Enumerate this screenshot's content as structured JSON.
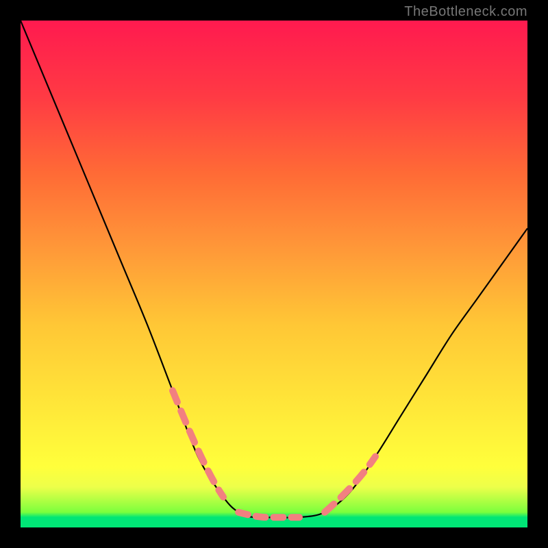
{
  "watermark": "TheBottleneck.com",
  "chart_data": {
    "type": "line",
    "title": "",
    "xlabel": "",
    "ylabel": "",
    "x": [
      0.0,
      0.05,
      0.1,
      0.15,
      0.2,
      0.25,
      0.3,
      0.35,
      0.4,
      0.43,
      0.46,
      0.5,
      0.55,
      0.6,
      0.65,
      0.7,
      0.75,
      0.8,
      0.85,
      0.9,
      0.95,
      1.0
    ],
    "values": [
      1.0,
      0.88,
      0.76,
      0.64,
      0.52,
      0.4,
      0.27,
      0.14,
      0.06,
      0.03,
      0.02,
      0.02,
      0.02,
      0.03,
      0.07,
      0.14,
      0.22,
      0.3,
      0.38,
      0.45,
      0.52,
      0.59
    ],
    "xlim": [
      0,
      1
    ],
    "ylim": [
      0,
      1
    ],
    "overlay_dash_segments_x": [
      [
        0.3,
        0.4
      ],
      [
        0.43,
        0.58
      ],
      [
        0.6,
        0.7
      ]
    ],
    "colors": {
      "line": "#000000",
      "overlay": "#f28080"
    }
  }
}
